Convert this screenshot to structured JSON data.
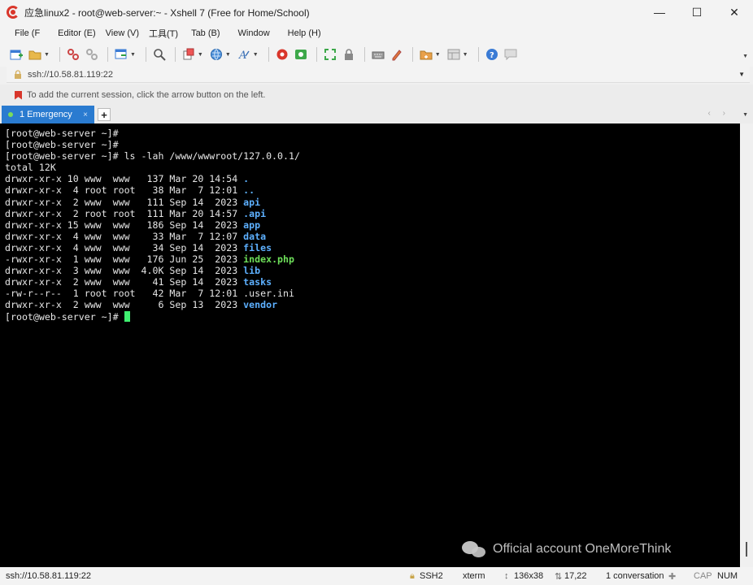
{
  "window": {
    "title": "应急linux2 - root@web-server:~ - Xshell 7 (Free for Home/School)",
    "controls": {
      "minimize": "—",
      "maximize": "☐",
      "close": "✕"
    }
  },
  "menu": [
    {
      "label": "File (F"
    },
    {
      "label": "Editor (E)"
    },
    {
      "label": "View (V)"
    },
    {
      "label": "工具(T)"
    },
    {
      "label": "Tab (B)"
    },
    {
      "label": "Window"
    },
    {
      "label": "Help (H)"
    }
  ],
  "toolbar": {
    "icons": [
      "new-session-icon",
      "open-folder-icon",
      "reconnect-icon",
      "disconnect-icon",
      "new-tab-icon",
      "find-icon",
      "copy-icon",
      "globe-icon",
      "font-icon",
      "xftp-icon",
      "xmanager-icon",
      "fullscreen-icon",
      "lock-icon",
      "keyboard-icon",
      "script-icon",
      "transfer-icon",
      "layout-icon",
      "help-icon",
      "chat-icon"
    ]
  },
  "address": {
    "text": "ssh://10.58.81.119:22"
  },
  "info": {
    "text": "To add the current session, click the arrow button on the left."
  },
  "tabs": [
    {
      "label": "1 Emergency",
      "close": "×"
    }
  ],
  "tab_add": "+",
  "tab_nav": "‹ ›",
  "terminal": {
    "lines": [
      {
        "segments": [
          {
            "t": "[root@web-server ~]#",
            "c": "n"
          }
        ]
      },
      {
        "segments": [
          {
            "t": "[root@web-server ~]#",
            "c": "n"
          }
        ]
      },
      {
        "segments": [
          {
            "t": "[root@web-server ~]# ls -lah /www/wwwroot/127.0.0.1/",
            "c": "n"
          }
        ]
      },
      {
        "segments": [
          {
            "t": "total 12K",
            "c": "n"
          }
        ]
      },
      {
        "segments": [
          {
            "t": "drwxr-xr-x 10 www  www   137 Mar 20 14:54 ",
            "c": "n"
          },
          {
            "t": ".",
            "c": "d"
          }
        ]
      },
      {
        "segments": [
          {
            "t": "drwxr-xr-x  4 root root   38 Mar  7 12:01 ",
            "c": "n"
          },
          {
            "t": "..",
            "c": "d"
          }
        ]
      },
      {
        "segments": [
          {
            "t": "drwxr-xr-x  2 www  www   111 Sep 14  2023 ",
            "c": "n"
          },
          {
            "t": "api",
            "c": "d"
          }
        ]
      },
      {
        "segments": [
          {
            "t": "drwxr-xr-x  2 root root  111 Mar 20 14:57 ",
            "c": "n"
          },
          {
            "t": ".api",
            "c": "d"
          }
        ]
      },
      {
        "segments": [
          {
            "t": "drwxr-xr-x 15 www  www   186 Sep 14  2023 ",
            "c": "n"
          },
          {
            "t": "app",
            "c": "d"
          }
        ]
      },
      {
        "segments": [
          {
            "t": "drwxr-xr-x  4 www  www    33 Mar  7 12:07 ",
            "c": "n"
          },
          {
            "t": "data",
            "c": "d"
          }
        ]
      },
      {
        "segments": [
          {
            "t": "drwxr-xr-x  4 www  www    34 Sep 14  2023 ",
            "c": "n"
          },
          {
            "t": "files",
            "c": "d"
          }
        ]
      },
      {
        "segments": [
          {
            "t": "-rwxr-xr-x  1 www  www   176 Jun 25  2023 ",
            "c": "n"
          },
          {
            "t": "index.php",
            "c": "x"
          }
        ]
      },
      {
        "segments": [
          {
            "t": "drwxr-xr-x  3 www  www  4.0K Sep 14  2023 ",
            "c": "n"
          },
          {
            "t": "lib",
            "c": "d"
          }
        ]
      },
      {
        "segments": [
          {
            "t": "drwxr-xr-x  2 www  www    41 Sep 14  2023 ",
            "c": "n"
          },
          {
            "t": "tasks",
            "c": "d"
          }
        ]
      },
      {
        "segments": [
          {
            "t": "-rw-r--r--  1 root root   42 Mar  7 12:01 .user.ini",
            "c": "n"
          }
        ]
      },
      {
        "segments": [
          {
            "t": "drwxr-xr-x  2 www  www     6 Sep 13  2023 ",
            "c": "n"
          },
          {
            "t": "vendor",
            "c": "d"
          }
        ]
      },
      {
        "segments": [
          {
            "t": "[root@web-server ~]# ",
            "c": "n"
          }
        ],
        "cursor": true
      }
    ]
  },
  "watermark": {
    "text": "Official account OneMoreThink"
  },
  "status": {
    "address": "ssh://10.58.81.119:22",
    "protocol": "SSH2",
    "term": "xterm",
    "size": "136x38",
    "position": "17,22",
    "sessions": "1 conversation",
    "cap": "CAP",
    "num": "NUM"
  },
  "colors": {
    "terminal_bg": "#000000",
    "terminal_fg": "#e6e6e6",
    "directory": "#5db0ff",
    "executable": "#6ee05a",
    "cursor": "#3ff070",
    "tab_active": "#2a7bd0"
  }
}
